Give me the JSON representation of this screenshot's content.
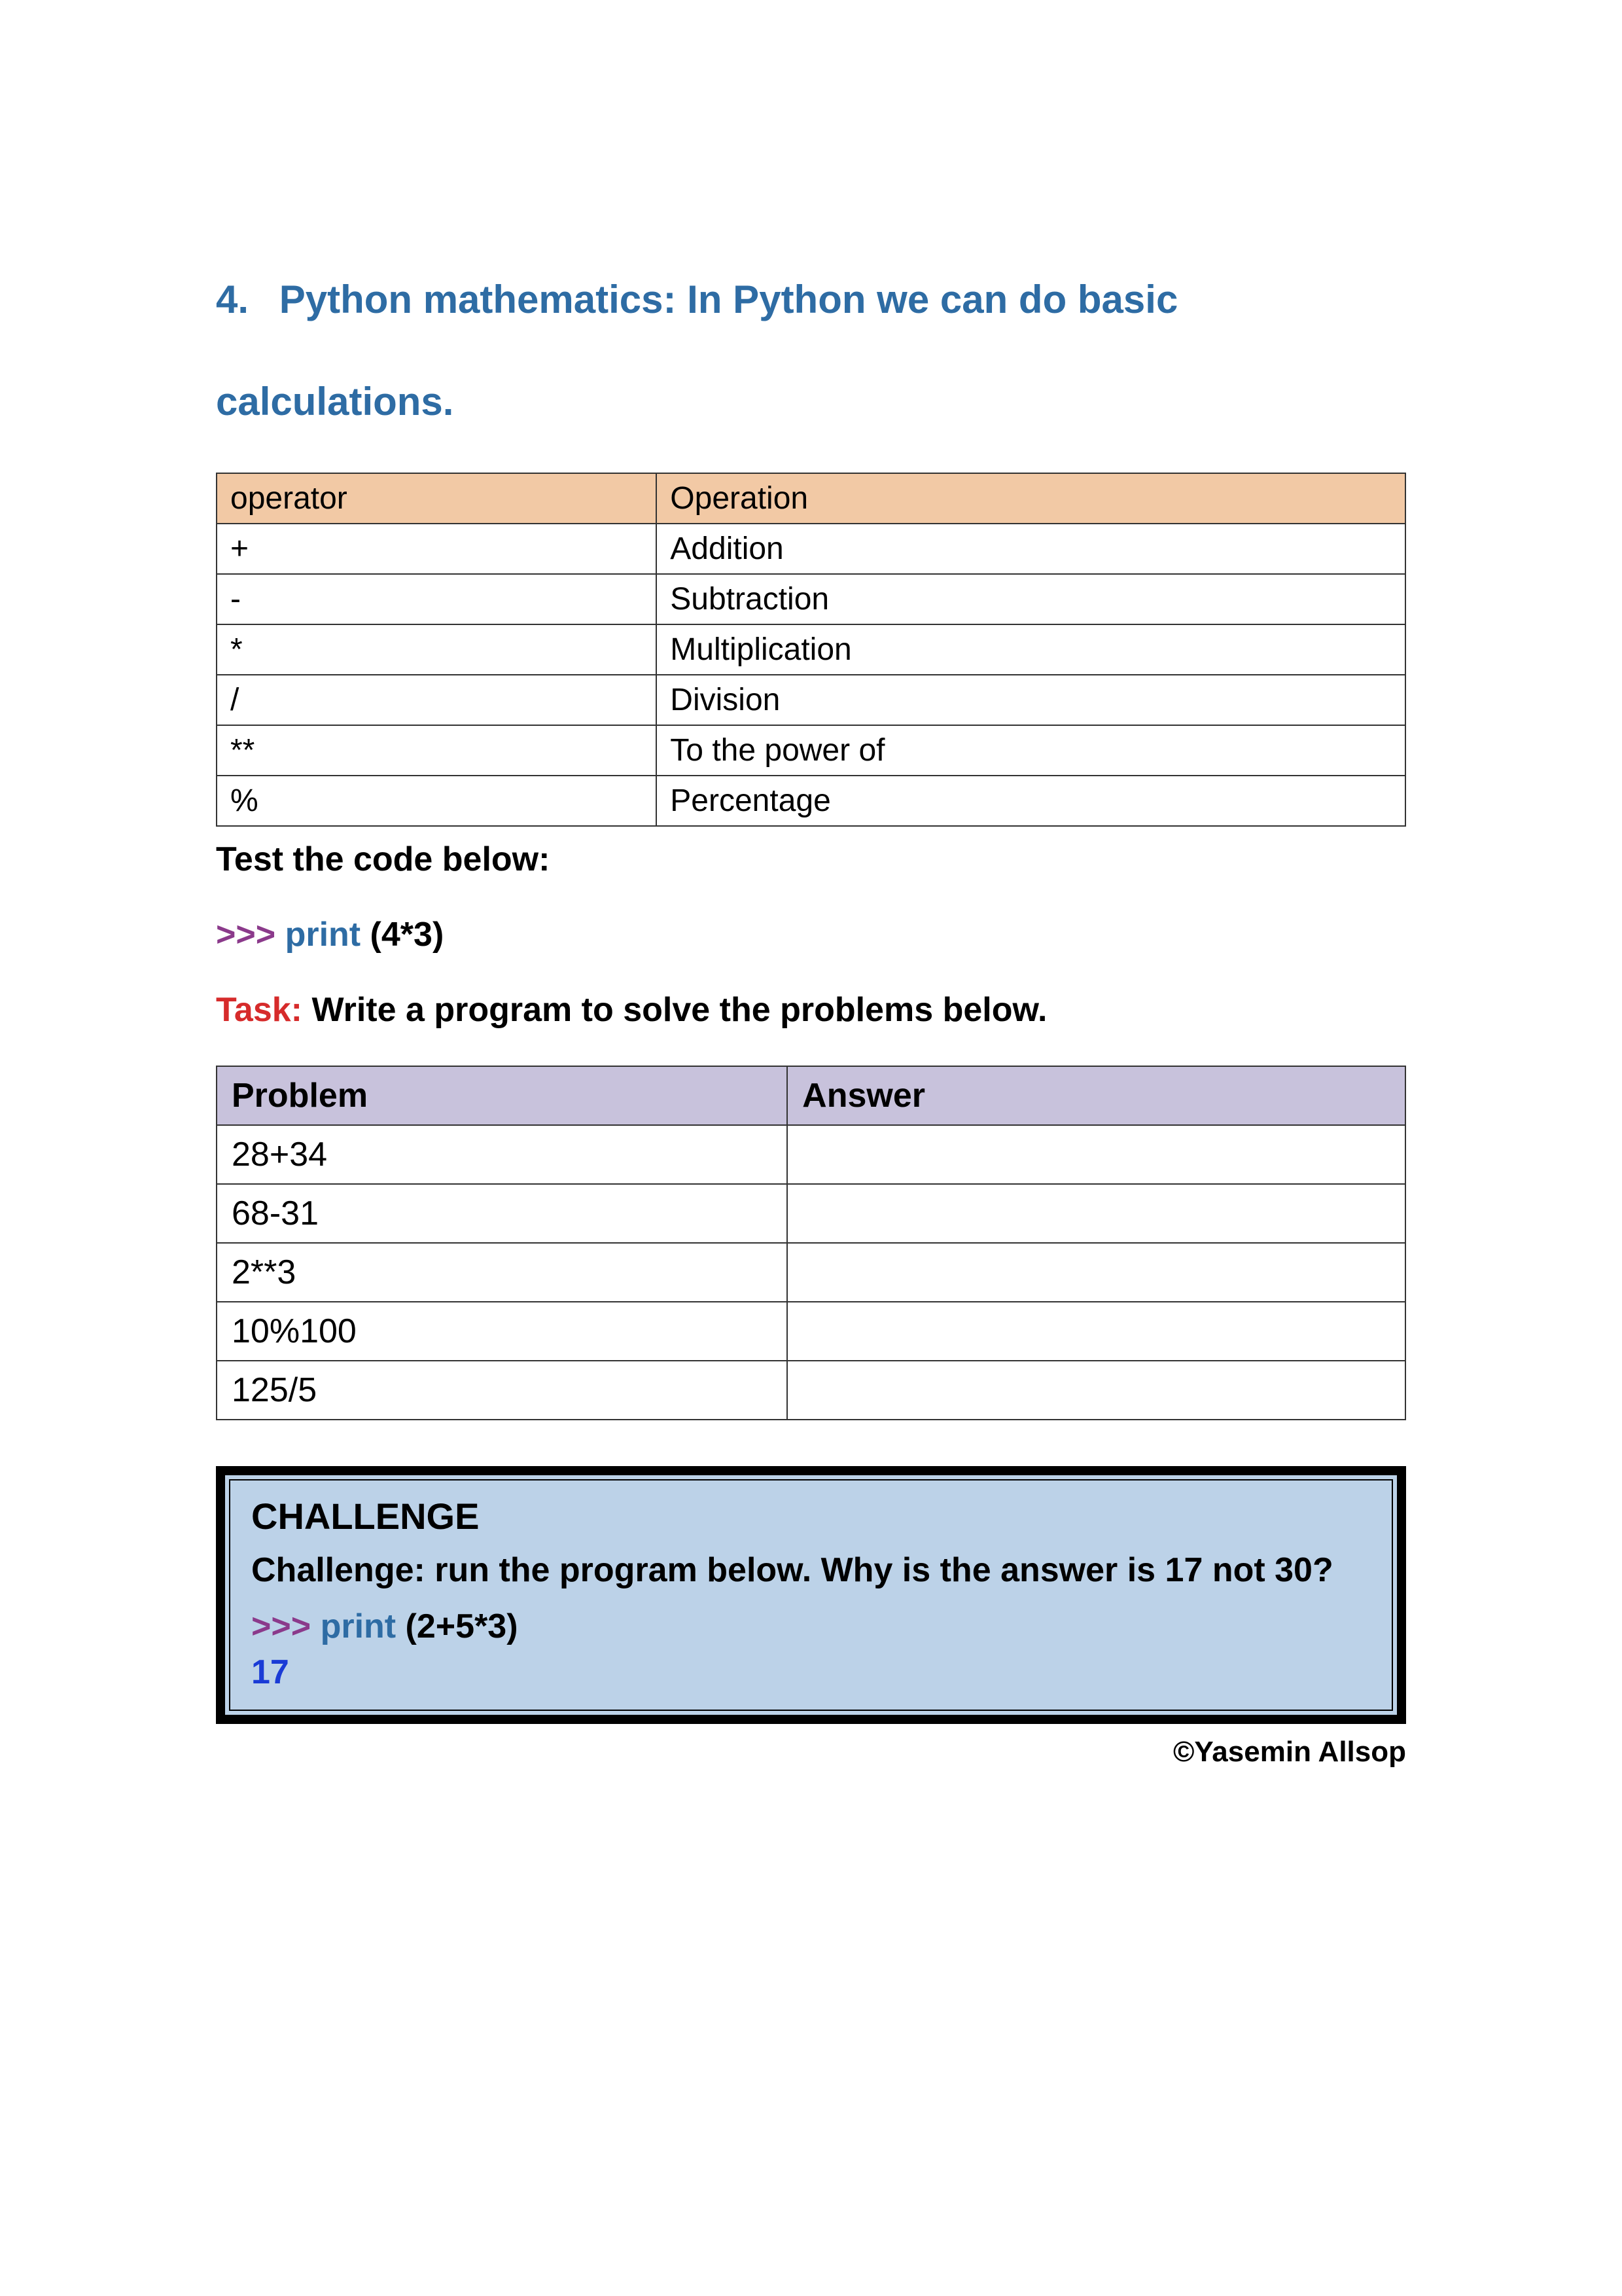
{
  "heading": {
    "number": "4.",
    "text": "Python mathematics: In Python we can do basic calculations."
  },
  "opsTable": {
    "headers": {
      "col1": "operator",
      "col2": "Operation"
    },
    "rows": [
      {
        "op": "+",
        "name": "Addition"
      },
      {
        "op": "-",
        "name": "Subtraction"
      },
      {
        "op": "*",
        "name": "Multiplication"
      },
      {
        "op": "/",
        "name": "Division"
      },
      {
        "op": "**",
        "name": "To the power of"
      },
      {
        "op": "%",
        "name": "Percentage"
      }
    ]
  },
  "testLabel": "Test the code below:",
  "codeExample": {
    "chevrons": ">>>",
    "keyword": "print",
    "args": "(4*3)"
  },
  "task": {
    "label": "Task:",
    "text": "Write a program to solve the problems below."
  },
  "problemTable": {
    "headers": {
      "col1": "Problem",
      "col2": "Answer"
    },
    "rows": [
      {
        "problem": "28+34",
        "answer": ""
      },
      {
        "problem": "68-31",
        "answer": ""
      },
      {
        "problem": "2**3",
        "answer": ""
      },
      {
        "problem": "10%100",
        "answer": ""
      },
      {
        "problem": "125/5",
        "answer": ""
      }
    ]
  },
  "challenge": {
    "title": "CHALLENGE",
    "text": "Challenge: run the program below. Why is the answer is 17 not 30?",
    "code": {
      "chevrons": ">>>",
      "keyword": "print",
      "args": "(2+5*3)"
    },
    "result": "17"
  },
  "footer": "©Yasemin Allsop"
}
